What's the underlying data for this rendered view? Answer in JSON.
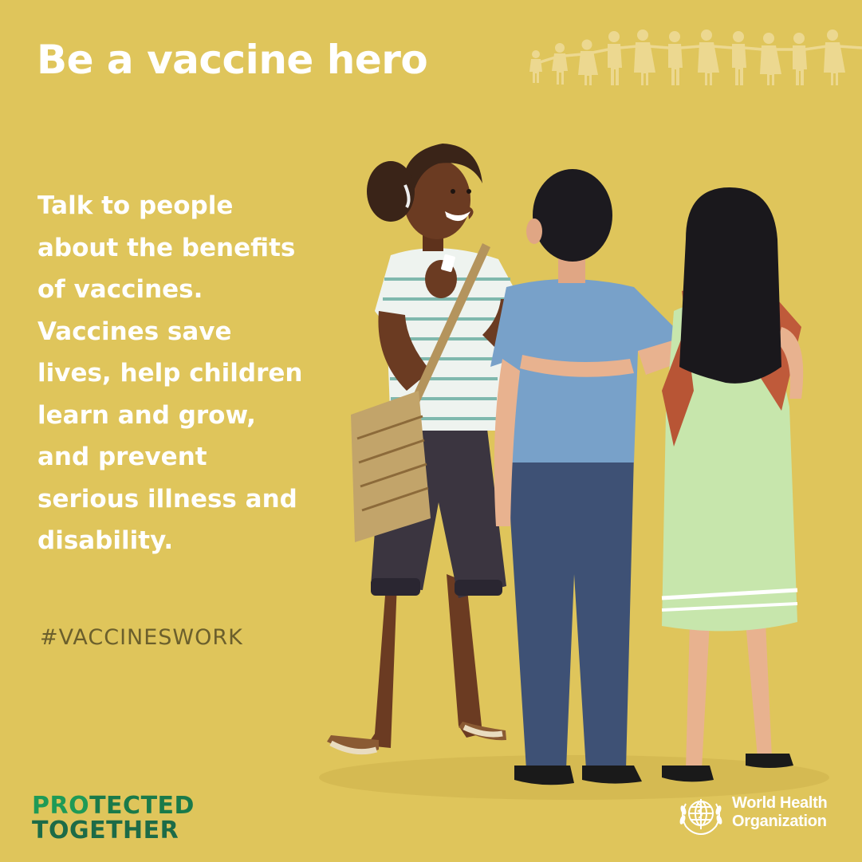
{
  "poster": {
    "title": "Be a vaccine hero",
    "body_lines": [
      "Talk to people",
      "about the benefits",
      "of vaccines.",
      "Vaccines save",
      "lives, help children",
      "learn and grow,",
      "and prevent",
      "serious illness and",
      "disability."
    ],
    "hashtag": "#VACCINESWORK"
  },
  "logos": {
    "campaign": {
      "line1_a": "PRO",
      "line1_b": "TECTED",
      "line2": "TOGETHER"
    },
    "who": {
      "line1": "World Health",
      "line2": "Organization"
    }
  },
  "colors": {
    "background": "#dfc55b",
    "title_text": "#ffffff",
    "hashtag_text": "#6b5f2c",
    "campaign_green": "#1a7a4a",
    "chain_figures": "#efdc9a"
  },
  "icons": {
    "people_chain": "people-chain-illustration",
    "who_emblem": "who-emblem-icon",
    "illustration": "three-people-talking-illustration"
  }
}
